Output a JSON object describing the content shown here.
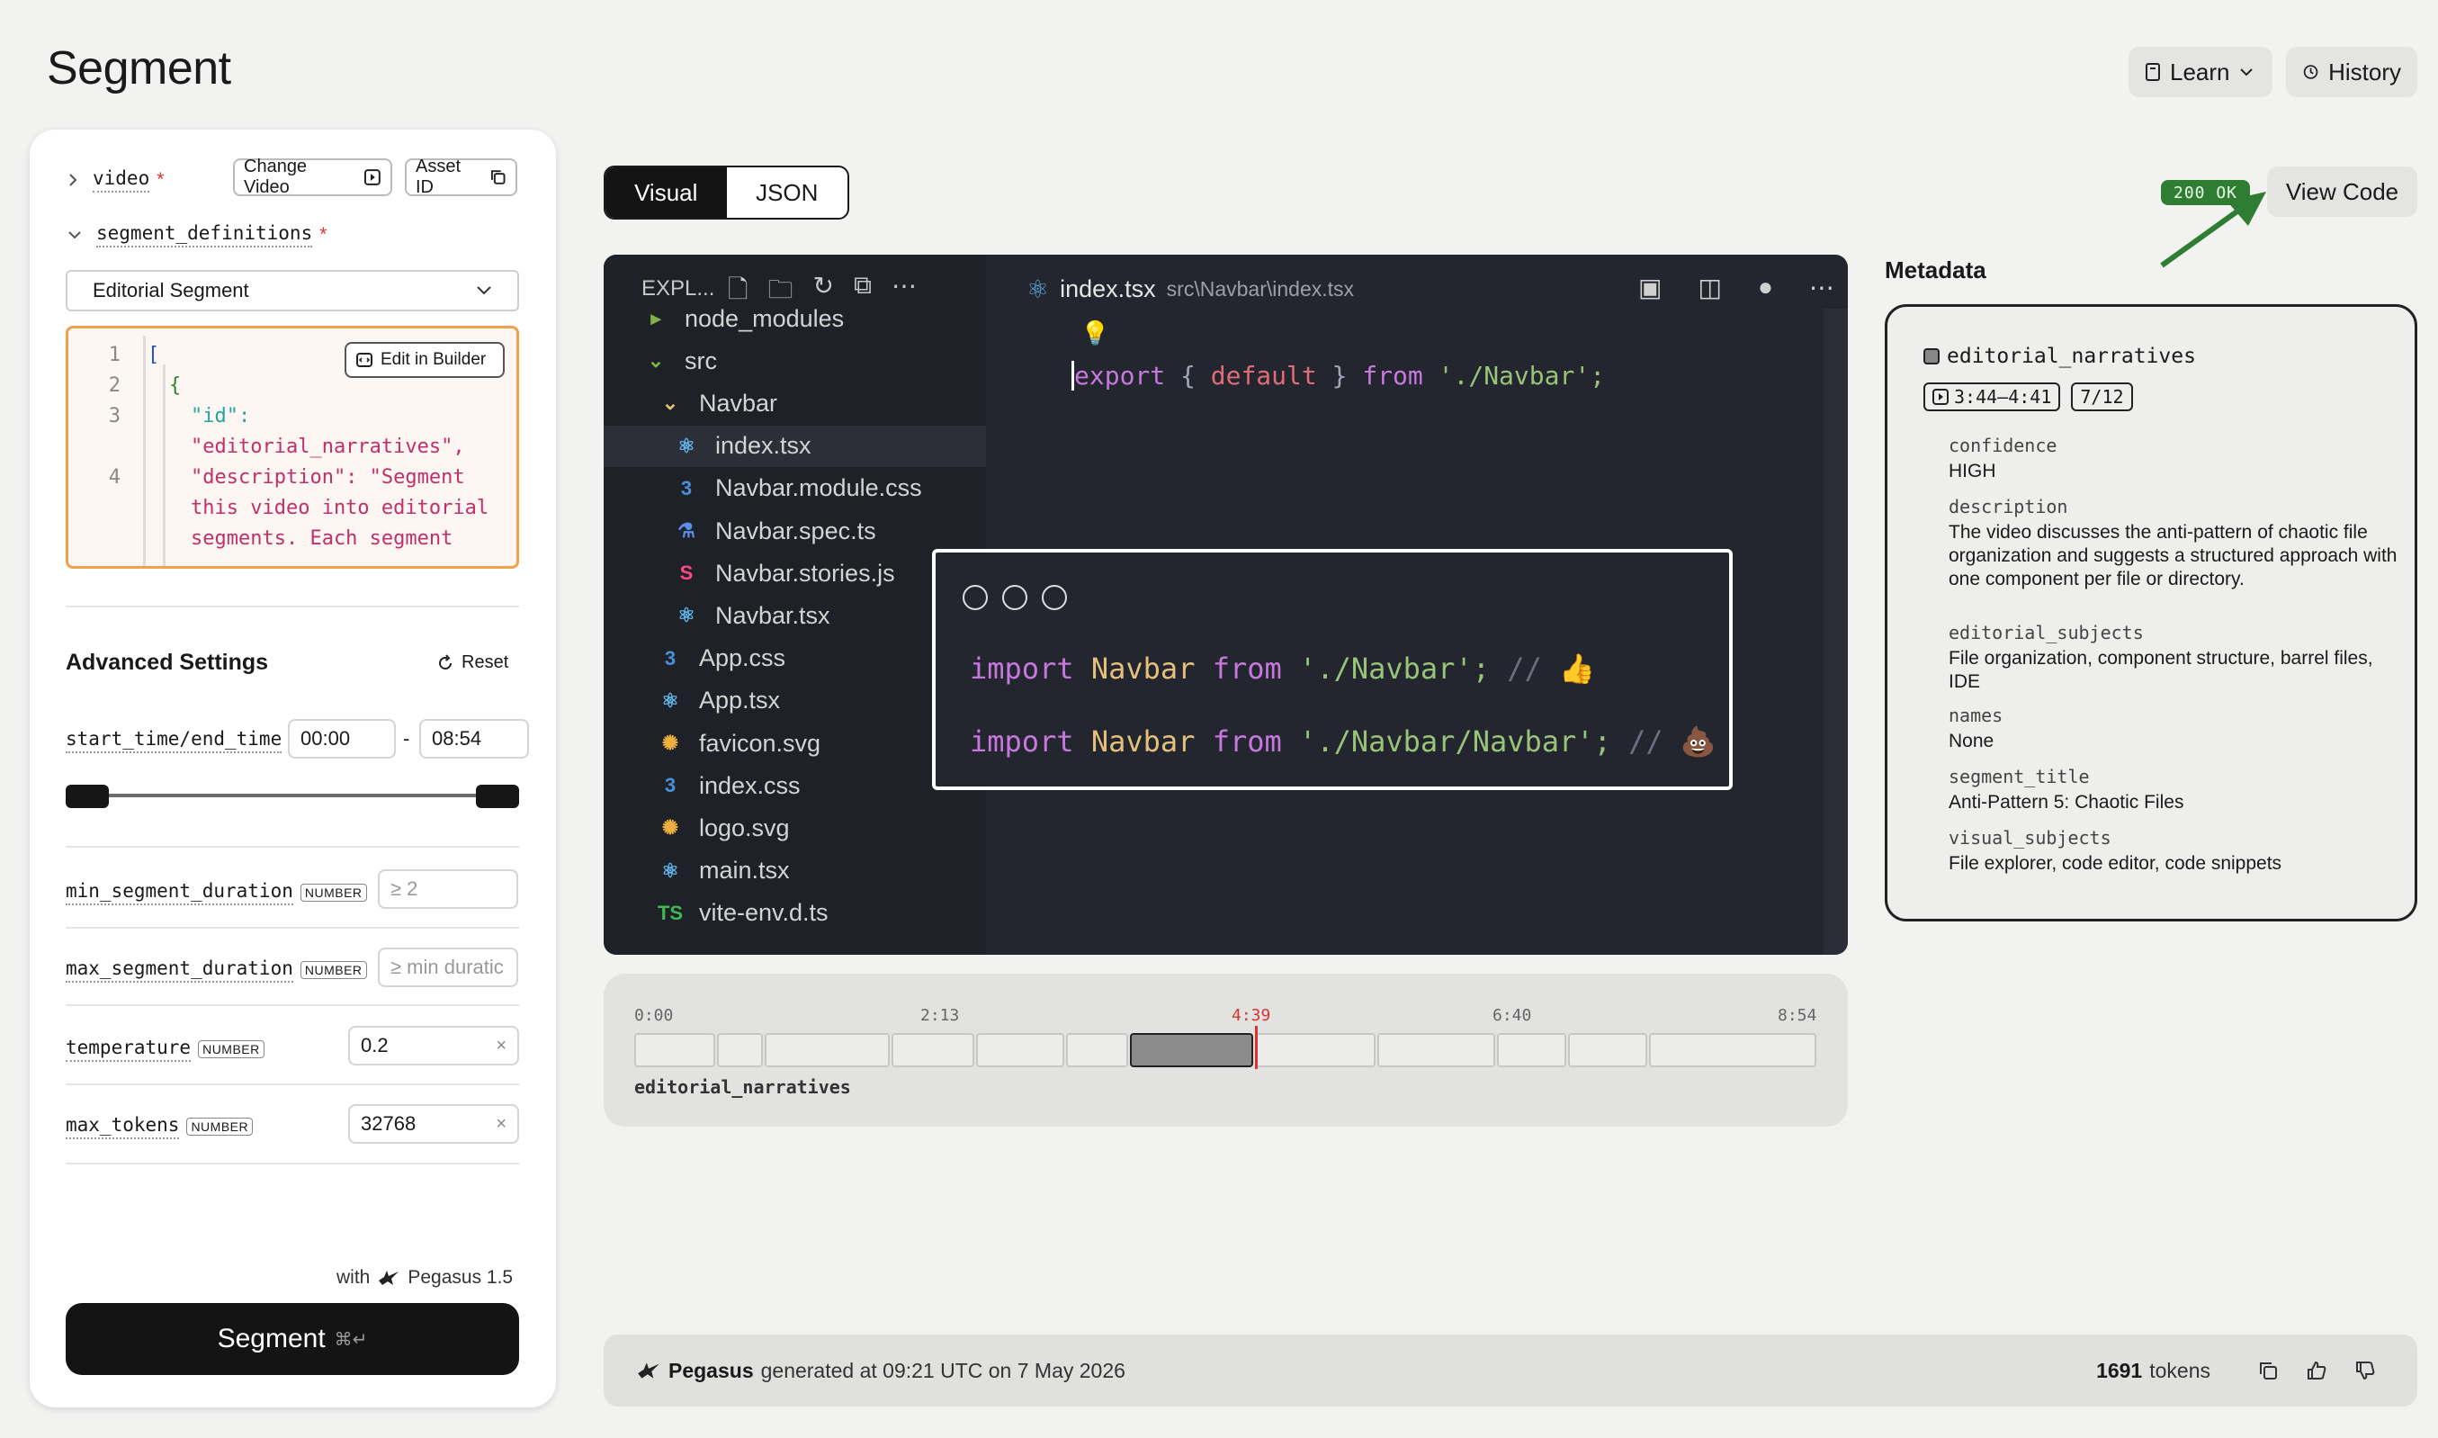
{
  "page": {
    "title": "Segment"
  },
  "header": {
    "learn_label": "Learn",
    "history_label": "History"
  },
  "form": {
    "video_label": "video",
    "required_mark": "*",
    "change_video_label": "Change Video",
    "asset_id_label": "Asset ID",
    "segment_definitions_label": "segment_definitions",
    "selected_definition": "Editorial Segment",
    "edit_in_builder_label": "Edit in Builder",
    "code_lines": [
      {
        "n": "1",
        "text": "["
      },
      {
        "n": "2",
        "text": "{"
      },
      {
        "n": "3",
        "text": "\"id\":"
      },
      {
        "n": "",
        "text": "\"editorial_narratives\","
      },
      {
        "n": "4",
        "text": "\"description\": \"Segment"
      },
      {
        "n": "",
        "text": "this video into editorial"
      },
      {
        "n": "",
        "text": "segments. Each segment"
      }
    ],
    "advanced_settings_label": "Advanced Settings",
    "reset_label": "Reset",
    "time_range_label": "start_time/end_time",
    "start_time": "00:00",
    "dash": "-",
    "end_time": "08:54",
    "min_duration_label": "min_segment_duration",
    "min_duration_placeholder": "≥ 2",
    "max_duration_label": "max_segment_duration",
    "max_duration_placeholder": "≥ min duratic",
    "temperature_label": "temperature",
    "temperature_value": "0.2",
    "max_tokens_label": "max_tokens",
    "max_tokens_value": "32768",
    "number_tag": "NUMBER",
    "clear_glyph": "×",
    "model_prefix": "with",
    "model_name": "Pegasus 1.5",
    "submit_label": "Segment",
    "submit_shortcut": "⌘↵"
  },
  "view": {
    "tab_visual": "Visual",
    "tab_json": "JSON",
    "status_badge": "200 OK",
    "view_code_label": "View Code"
  },
  "editor": {
    "explorer_label": "EXPL...",
    "tab_filename": "index.tsx",
    "tab_path": "src\\Navbar\\index.tsx",
    "code_export": "export",
    "code_brace_open": "{",
    "code_default": "default",
    "code_brace_close": "}",
    "code_from": "from",
    "code_path": "'./Navbar';",
    "files": [
      {
        "name": "node_modules",
        "indent": 1,
        "icon": "folder-icon",
        "glyph": "▸"
      },
      {
        "name": "src",
        "indent": 1,
        "icon": "folder-icon",
        "glyph": "⌄"
      },
      {
        "name": "Navbar",
        "indent": 2,
        "icon": "folder-open-icon",
        "glyph": "⌄"
      },
      {
        "name": "index.tsx",
        "indent": 3,
        "icon": "react-icon",
        "glyph": "⚛",
        "selected": true
      },
      {
        "name": "Navbar.module.css",
        "indent": 3,
        "icon": "css-icon",
        "glyph": "3"
      },
      {
        "name": "Navbar.spec.ts",
        "indent": 3,
        "icon": "test-icon",
        "glyph": "⚗"
      },
      {
        "name": "Navbar.stories.js",
        "indent": 3,
        "icon": "storybook-icon",
        "glyph": "S"
      },
      {
        "name": "Navbar.tsx",
        "indent": 3,
        "icon": "react-icon",
        "glyph": "⚛"
      },
      {
        "name": "App.css",
        "indent": 2,
        "icon": "css-icon",
        "glyph": "3"
      },
      {
        "name": "App.tsx",
        "indent": 2,
        "icon": "react-icon",
        "glyph": "⚛"
      },
      {
        "name": "favicon.svg",
        "indent": 2,
        "icon": "svg-icon",
        "glyph": "✺"
      },
      {
        "name": "index.css",
        "indent": 2,
        "icon": "css-icon",
        "glyph": "3"
      },
      {
        "name": "logo.svg",
        "indent": 2,
        "icon": "svg-icon",
        "glyph": "✺"
      },
      {
        "name": "main.tsx",
        "indent": 2,
        "icon": "react-icon",
        "glyph": "⚛"
      },
      {
        "name": "vite-env.d.ts",
        "indent": 2,
        "icon": "typescript-icon",
        "glyph": "TS"
      }
    ],
    "popup_line1": {
      "kw": "import",
      "name": "Navbar",
      "from": "from",
      "path": "'./Navbar';",
      "comment": "//",
      "emoji": "👍"
    },
    "popup_line2": {
      "kw": "import",
      "name": "Navbar",
      "from": "from",
      "path": "'./Navbar/Navbar';",
      "comment": "//",
      "emoji": "💩"
    }
  },
  "timeline": {
    "ticks": [
      "0:00",
      "2:13",
      "4:39",
      "6:40",
      "8:54"
    ],
    "playhead_time": "4:39",
    "track_label": "editorial_narratives",
    "playhead_fraction": 0.524,
    "segment_count": 12,
    "active_segment": 7
  },
  "metadata": {
    "title": "Metadata",
    "segment_name": "editorial_narratives",
    "time_range": "3:44–4:41",
    "index": "7/12",
    "fields": [
      {
        "key": "confidence",
        "value": "HIGH"
      },
      {
        "key": "description",
        "value": "The video discusses the anti-pattern of chaotic file organization and suggests a structured approach with one component per file or directory."
      },
      {
        "key": "editorial_subjects",
        "value": "File organization, component structure, barrel files, IDE"
      },
      {
        "key": "names",
        "value": "None"
      },
      {
        "key": "segment_title",
        "value": "Anti-Pattern 5: Chaotic Files"
      },
      {
        "key": "visual_subjects",
        "value": "File explorer, code editor, code snippets"
      }
    ]
  },
  "footer": {
    "model": "Pegasus",
    "generated_text": "generated at 09:21 UTC on 7 May 2026",
    "token_count": "1691",
    "tokens_label": "tokens"
  },
  "colors": {
    "accent_orange": "#f0a14a",
    "status_green": "#2f7d32",
    "playhead_red": "#d9342b",
    "editor_bg": "#23262f"
  }
}
